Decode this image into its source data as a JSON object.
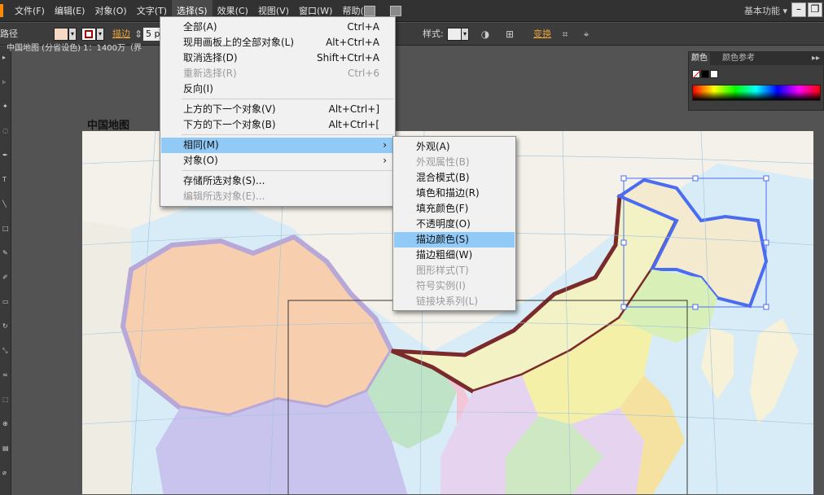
{
  "menubar": {
    "items": [
      "文件(F)",
      "编辑(E)",
      "对象(O)",
      "文字(T)",
      "选择(S)",
      "效果(C)",
      "视图(V)",
      "窗口(W)",
      "帮助(H)"
    ],
    "workspace": "基本功能",
    "workspace_arrow": "▾",
    "minimize": "–",
    "restore": "❐"
  },
  "controlbar": {
    "path_label": "路径",
    "stroke_label": "描边",
    "stroke_value": "5 p",
    "style_label": "样式:",
    "transform_label": "变换"
  },
  "document": {
    "tab_label": "中国地图  (分省设色)   1：1400万（界"
  },
  "map": {
    "title": "中国地图"
  },
  "color_panel": {
    "tab_color": "颜色",
    "tab_guide": "颜色参考",
    "menu_icon": "▸▸"
  },
  "select_menu": {
    "items": [
      {
        "label": "全部(A)",
        "shortcut": "Ctrl+A",
        "enabled": true
      },
      {
        "label": "现用画板上的全部对象(L)",
        "shortcut": "Alt+Ctrl+A",
        "enabled": true
      },
      {
        "label": "取消选择(D)",
        "shortcut": "Shift+Ctrl+A",
        "enabled": true
      },
      {
        "label": "重新选择(R)",
        "shortcut": "Ctrl+6",
        "enabled": false
      },
      {
        "label": "反向(I)",
        "shortcut": "",
        "enabled": true
      },
      {
        "label": "上方的下一个对象(V)",
        "shortcut": "Alt+Ctrl+]",
        "enabled": true
      },
      {
        "label": "下方的下一个对象(B)",
        "shortcut": "Alt+Ctrl+[",
        "enabled": true
      },
      {
        "label": "相同(M)",
        "shortcut": "",
        "enabled": true
      },
      {
        "label": "对象(O)",
        "shortcut": "",
        "enabled": true
      },
      {
        "label": "存储所选对象(S)...",
        "shortcut": "",
        "enabled": true
      },
      {
        "label": "编辑所选对象(E)...",
        "shortcut": "",
        "enabled": false
      }
    ],
    "submenu_arrow": "›"
  },
  "same_submenu": {
    "items": [
      {
        "label": "外观(A)",
        "enabled": true
      },
      {
        "label": "外观属性(B)",
        "enabled": false
      },
      {
        "label": "混合模式(B)",
        "enabled": true
      },
      {
        "label": "填色和描边(R)",
        "enabled": true
      },
      {
        "label": "填充颜色(F)",
        "enabled": true
      },
      {
        "label": "不透明度(O)",
        "enabled": true
      },
      {
        "label": "描边颜色(S)",
        "enabled": true
      },
      {
        "label": "描边粗细(W)",
        "enabled": true
      },
      {
        "label": "图形样式(T)",
        "enabled": false
      },
      {
        "label": "符号实例(I)",
        "enabled": false
      },
      {
        "label": "链接块系列(L)",
        "enabled": false
      }
    ]
  },
  "colors": {
    "accent_orange": "#ff8a00",
    "menu_highlight": "#91c9f7",
    "selection_blue": "#4a6cf0",
    "province_outline": "#7a2a2a"
  }
}
